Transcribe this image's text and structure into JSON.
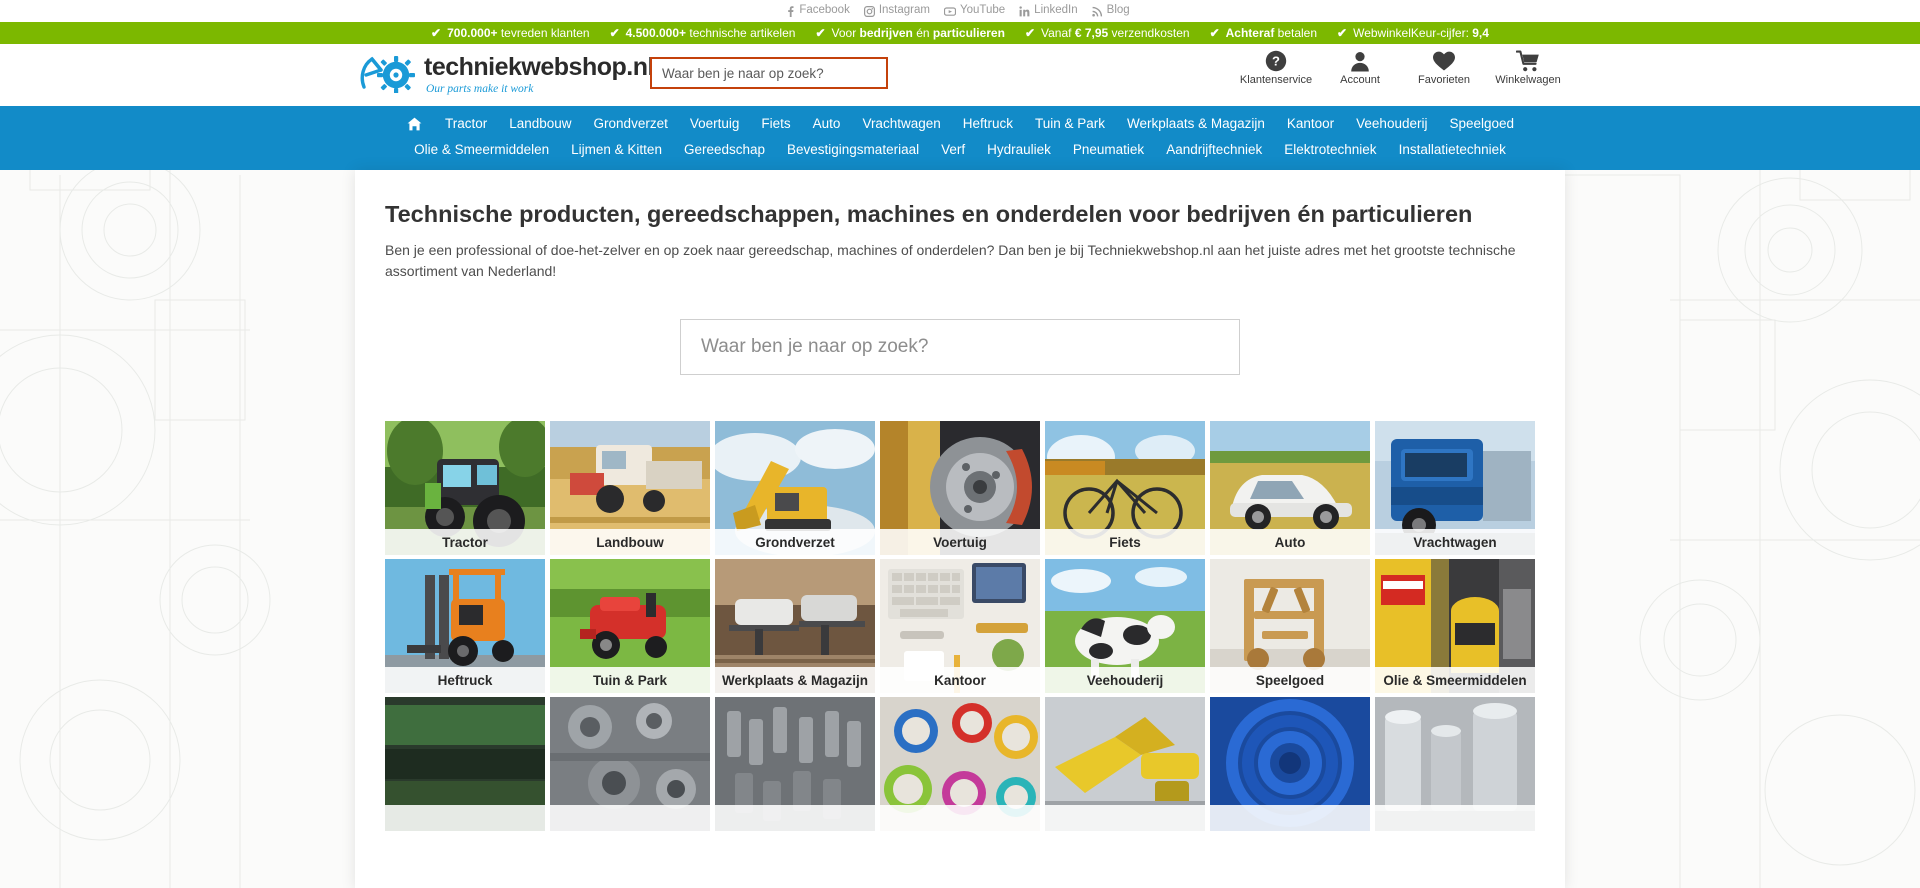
{
  "social": {
    "links": [
      {
        "label": "Facebook",
        "icon": "facebook-icon"
      },
      {
        "label": "Instagram",
        "icon": "instagram-icon"
      },
      {
        "label": "YouTube",
        "icon": "youtube-icon"
      },
      {
        "label": "LinkedIn",
        "icon": "linkedin-icon"
      },
      {
        "label": "Blog",
        "icon": "rss-icon"
      }
    ]
  },
  "usp": {
    "background_color": "#7cb800",
    "items": [
      {
        "strong": "700.000+",
        "rest": " tevreden klanten"
      },
      {
        "strong": "4.500.000+",
        "rest": " technische artikelen"
      },
      {
        "pre": "Voor ",
        "strong": "bedrijven",
        "mid": " én ",
        "strong2": "particulieren"
      },
      {
        "pre": "Vanaf ",
        "strong": "€ 7,95",
        "rest": " verzendkosten"
      },
      {
        "strong": "Achteraf",
        "rest": " betalen"
      },
      {
        "pre": "WebwinkelKeur-cijfer: ",
        "strong": "9,4"
      }
    ]
  },
  "header": {
    "logo_name": "techniekwebshop.nl",
    "logo_tagline": "Our parts make it work",
    "logo_color": "#1a9ad7",
    "search": {
      "placeholder": "Waar ben je naar op zoek?",
      "value": "",
      "border_color": "#c4410b"
    },
    "actions": [
      {
        "label": "Klantenservice",
        "icon": "question-circle-icon"
      },
      {
        "label": "Account",
        "icon": "user-icon"
      },
      {
        "label": "Favorieten",
        "icon": "heart-icon"
      },
      {
        "label": "Winkelwagen",
        "icon": "cart-icon"
      }
    ]
  },
  "nav": {
    "background_color": "#128bc8",
    "home_icon": "home-icon",
    "row1": [
      "Tractor",
      "Landbouw",
      "Grondverzet",
      "Voertuig",
      "Fiets",
      "Auto",
      "Vrachtwagen",
      "Heftruck",
      "Tuin & Park",
      "Werkplaats & Magazijn",
      "Kantoor",
      "Veehouderij",
      "Speelgoed"
    ],
    "row2": [
      "Olie & Smeermiddelen",
      "Lijmen & Kitten",
      "Gereedschap",
      "Bevestigingsmateriaal",
      "Verf",
      "Hydrauliek",
      "Pneumatiek",
      "Aandrijftechniek",
      "Elektrotechniek",
      "Installatietechniek"
    ]
  },
  "main": {
    "title": "Technische producten, gereedschappen, machines en onderdelen voor bedrijven én particulieren",
    "intro": "Ben je een professional of doe-het-zelver en op zoek naar gereedschap, machines of onderdelen? Dan ben je bij Techniekwebshop.nl aan het juiste adres met het grootste technische assortiment van Nederland!",
    "hero_search": {
      "placeholder": "Waar ben je naar op zoek?",
      "value": ""
    },
    "categories": [
      {
        "label": "Tractor",
        "image": "green-tractor-field"
      },
      {
        "label": "Landbouw",
        "image": "combine-harvester-wheat"
      },
      {
        "label": "Grondverzet",
        "image": "yellow-excavator-sky"
      },
      {
        "label": "Voertuig",
        "image": "brake-disc-closeup"
      },
      {
        "label": "Fiets",
        "image": "bicycle-autumn-field"
      },
      {
        "label": "Auto",
        "image": "white-car-field"
      },
      {
        "label": "Vrachtwagen",
        "image": "blue-truck-cab"
      },
      {
        "label": "Heftruck",
        "image": "orange-forklift-sky"
      },
      {
        "label": "Tuin & Park",
        "image": "red-lawnmower-grass"
      },
      {
        "label": "Werkplaats & Magazijn",
        "image": "car-lift-garage"
      },
      {
        "label": "Kantoor",
        "image": "desk-keyboard-supplies"
      },
      {
        "label": "Veehouderij",
        "image": "cows-pasture"
      },
      {
        "label": "Speelgoed",
        "image": "wooden-toy-model"
      },
      {
        "label": "Olie & Smeermiddelen",
        "image": "kroon-oil-cans"
      },
      {
        "label": "",
        "image": "dark-green-panel"
      },
      {
        "label": "",
        "image": "bearings-tools"
      },
      {
        "label": "",
        "image": "bolts-nuts-steel"
      },
      {
        "label": "",
        "image": "paint-cans-colors"
      },
      {
        "label": "",
        "image": "yellow-hydraulic-part"
      },
      {
        "label": "",
        "image": "blue-hose-coil"
      },
      {
        "label": "",
        "image": "metal-pipes-fittings"
      }
    ]
  }
}
